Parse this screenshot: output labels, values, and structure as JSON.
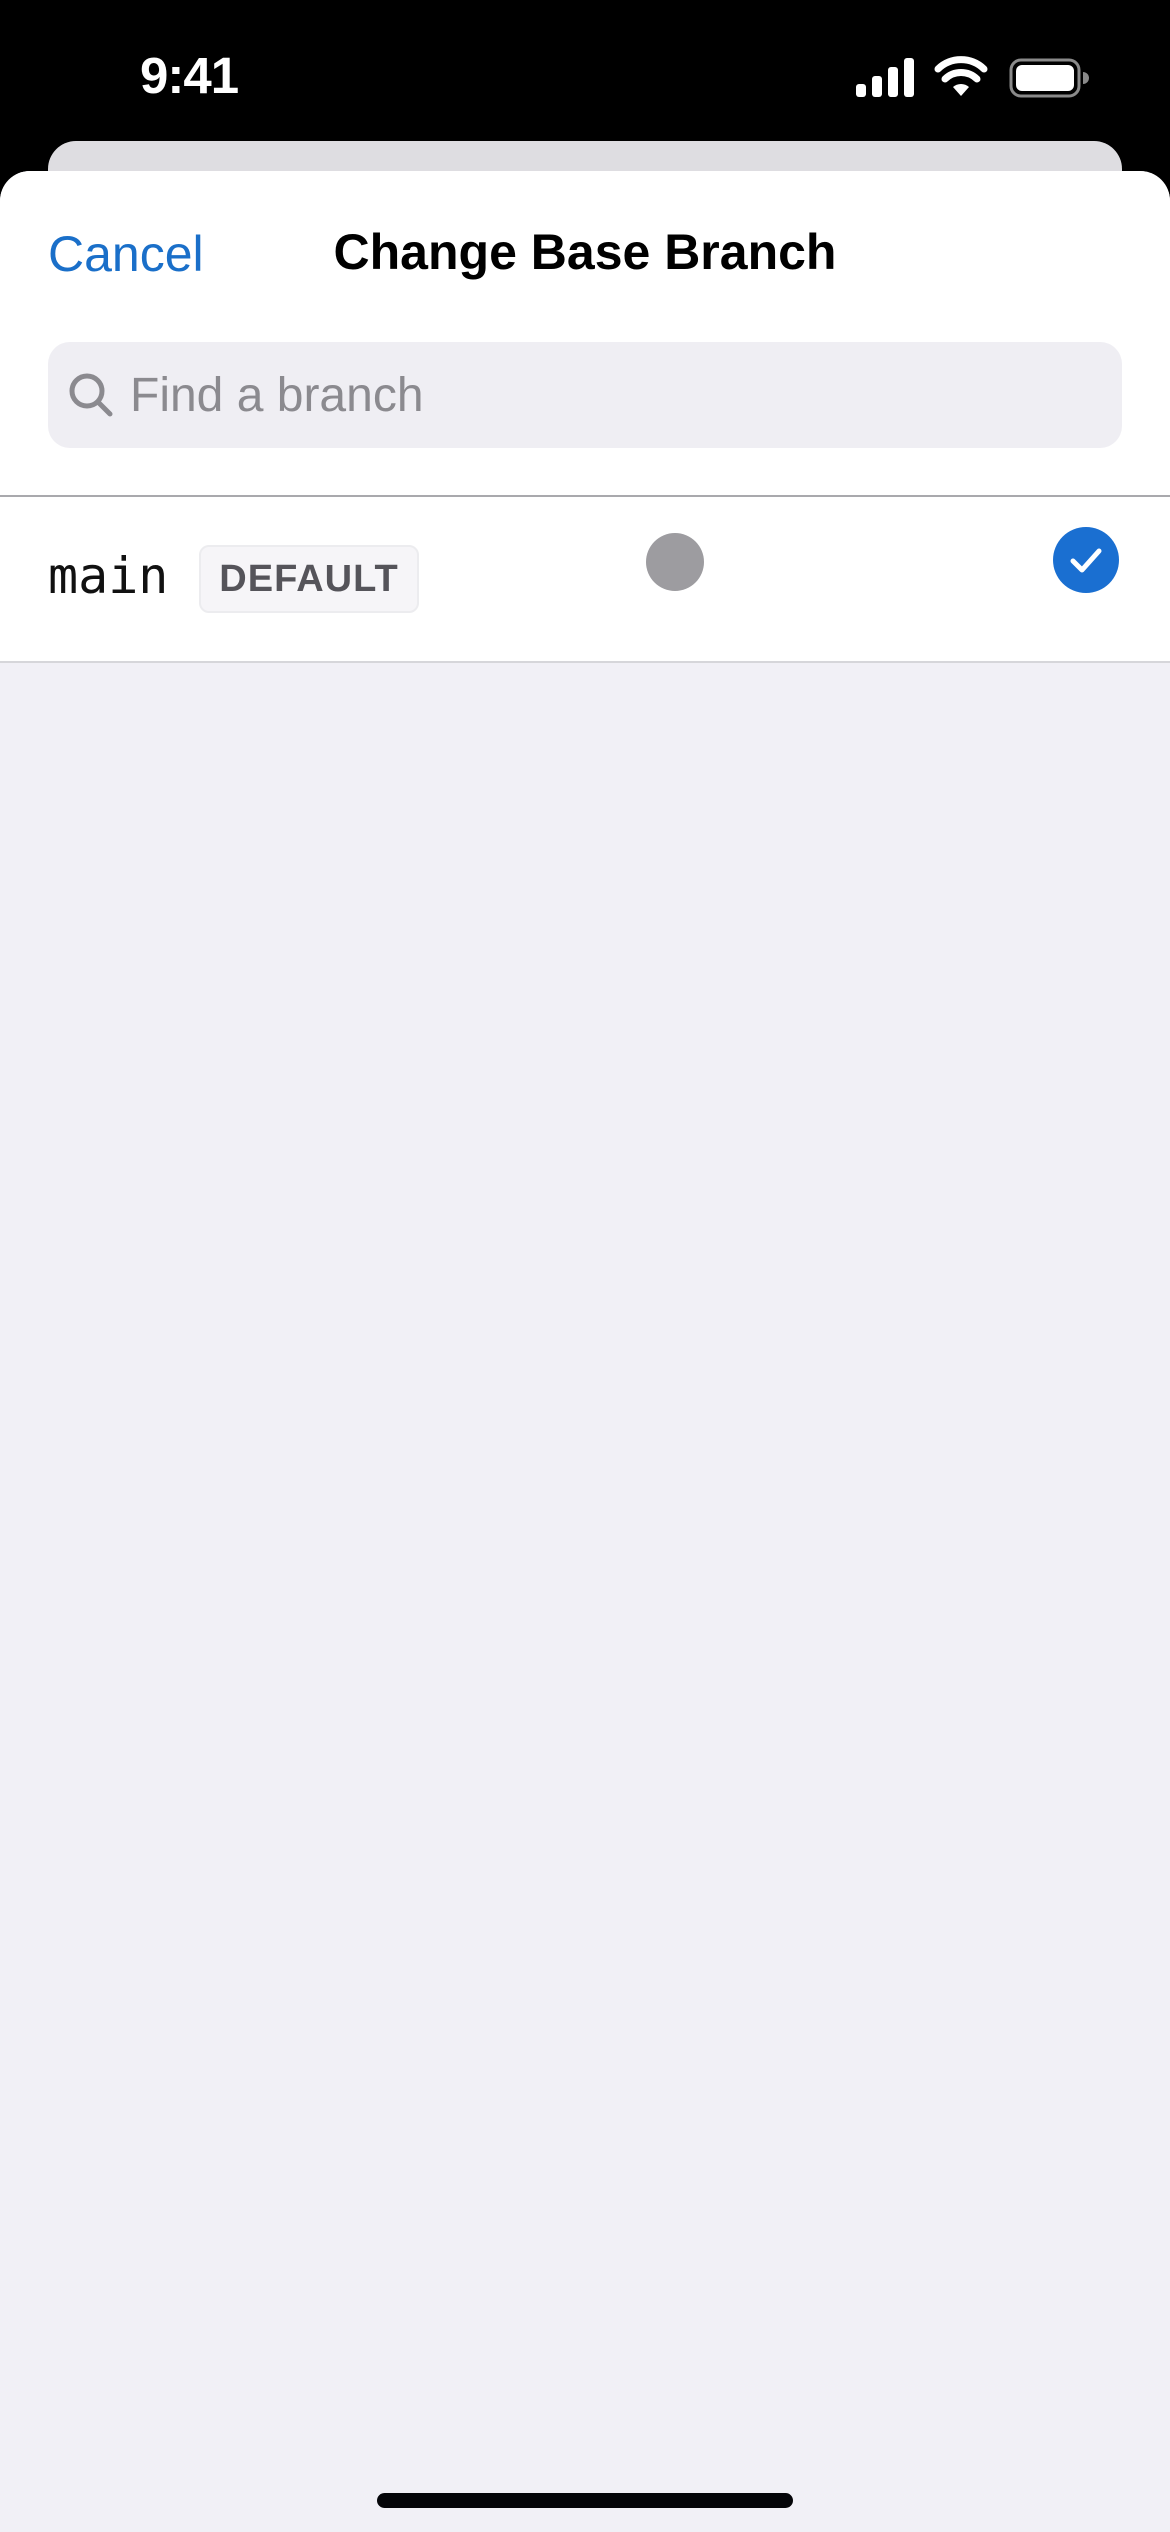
{
  "status_bar": {
    "time": "9:41",
    "icons": [
      "cellular-signal-icon",
      "wifi-icon",
      "battery-icon"
    ]
  },
  "sheet": {
    "cancel_label": "Cancel",
    "title": "Change Base Branch",
    "search": {
      "placeholder": "Find a branch",
      "value": "",
      "icon": "search-icon"
    },
    "branches": [
      {
        "name": "main",
        "badge": "DEFAULT",
        "selected": true,
        "status_icon": "status-dot-icon"
      }
    ]
  },
  "colors": {
    "accent": "#1a6fc9",
    "check_fill": "#1a6fd1",
    "status_dot": "#9d9ca0",
    "background": "#f1f0f6"
  }
}
